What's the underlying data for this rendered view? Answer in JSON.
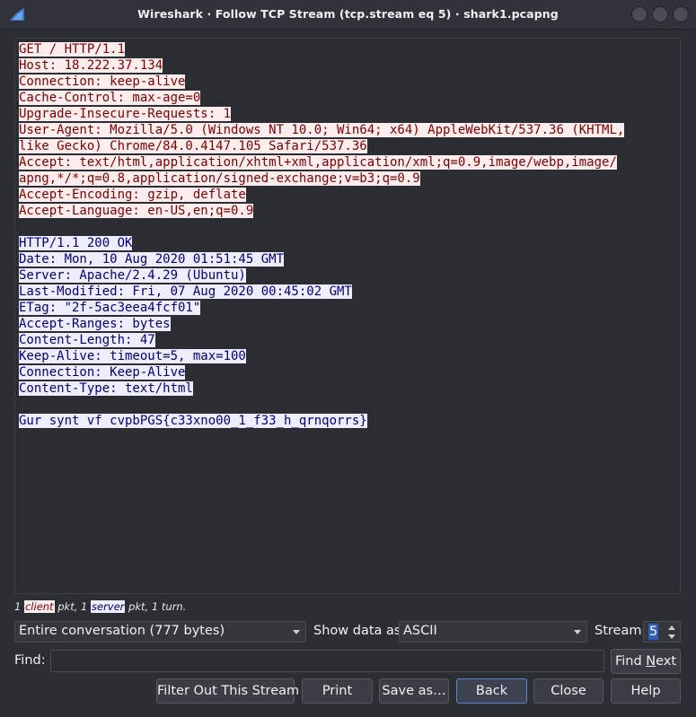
{
  "window": {
    "title": "Wireshark · Follow TCP Stream (tcp.stream eq 5) · shark1.pcapng",
    "app_icon": "wireshark-fin-icon",
    "controls": [
      "minimize-icon",
      "maximize-icon",
      "close-icon"
    ]
  },
  "colors": {
    "client_bg": "#fbeded",
    "client_fg": "#7f0000",
    "server_bg": "#ededfb",
    "server_fg": "#00007f"
  },
  "stream": {
    "lines": [
      {
        "text": "GET / HTTP/1.1",
        "side": "client"
      },
      {
        "text": "Host: 18.222.37.134",
        "side": "client"
      },
      {
        "text": "Connection: keep-alive",
        "side": "client"
      },
      {
        "text": "Cache-Control: max-age=0",
        "side": "client"
      },
      {
        "text": "Upgrade-Insecure-Requests: 1",
        "side": "client"
      },
      {
        "text": "User-Agent: Mozilla/5.0 (Windows NT 10.0; Win64; x64) AppleWebKit/537.36 (KHTML,",
        "side": "client"
      },
      {
        "text": "like Gecko) Chrome/84.0.4147.105 Safari/537.36",
        "side": "client"
      },
      {
        "text": "Accept: text/html,application/xhtml+xml,application/xml;q=0.9,image/webp,image/",
        "side": "client"
      },
      {
        "text": "apng,*/*;q=0.8,application/signed-exchange;v=b3;q=0.9",
        "side": "client"
      },
      {
        "text": "Accept-Encoding: gzip, deflate",
        "side": "client"
      },
      {
        "text": "Accept-Language: en-US,en;q=0.9",
        "side": "client"
      },
      {
        "text": "",
        "side": "none"
      },
      {
        "text": "HTTP/1.1 200 OK",
        "side": "server"
      },
      {
        "text": "Date: Mon, 10 Aug 2020 01:51:45 GMT",
        "side": "server"
      },
      {
        "text": "Server: Apache/2.4.29 (Ubuntu)",
        "side": "server"
      },
      {
        "text": "Last-Modified: Fri, 07 Aug 2020 00:45:02 GMT",
        "side": "server"
      },
      {
        "text": "ETag: \"2f-5ac3eea4fcf01\"",
        "side": "server"
      },
      {
        "text": "Accept-Ranges: bytes",
        "side": "server"
      },
      {
        "text": "Content-Length: 47",
        "side": "server"
      },
      {
        "text": "Keep-Alive: timeout=5, max=100",
        "side": "server"
      },
      {
        "text": "Connection: Keep-Alive",
        "side": "server"
      },
      {
        "text": "Content-Type: text/html",
        "side": "server"
      },
      {
        "text": "",
        "side": "none"
      },
      {
        "text": "Gur synt vf cvpbPGS{c33xno00_1_f33_h_qrnqorrs}",
        "side": "server"
      }
    ]
  },
  "summary": {
    "prefix": "1 ",
    "client_word": "client",
    "middle": " pkt, 1 ",
    "server_word": "server",
    "suffix": " pkt, 1 turn."
  },
  "controls": {
    "conversation": "Entire conversation (777 bytes)",
    "show_data_as_label": "Show data as",
    "show_data_as": "ASCII",
    "stream_label": "Stream",
    "stream_value": "5"
  },
  "find": {
    "label": "Find:",
    "value": "",
    "find_next_prefix": "Find ",
    "find_next_mnemonic": "N",
    "find_next_suffix": "ext"
  },
  "buttons": {
    "filter_out": "Filter Out This Stream",
    "print": "Print",
    "save_as": "Save as…",
    "back": "Back",
    "close": "Close",
    "help": "Help"
  }
}
